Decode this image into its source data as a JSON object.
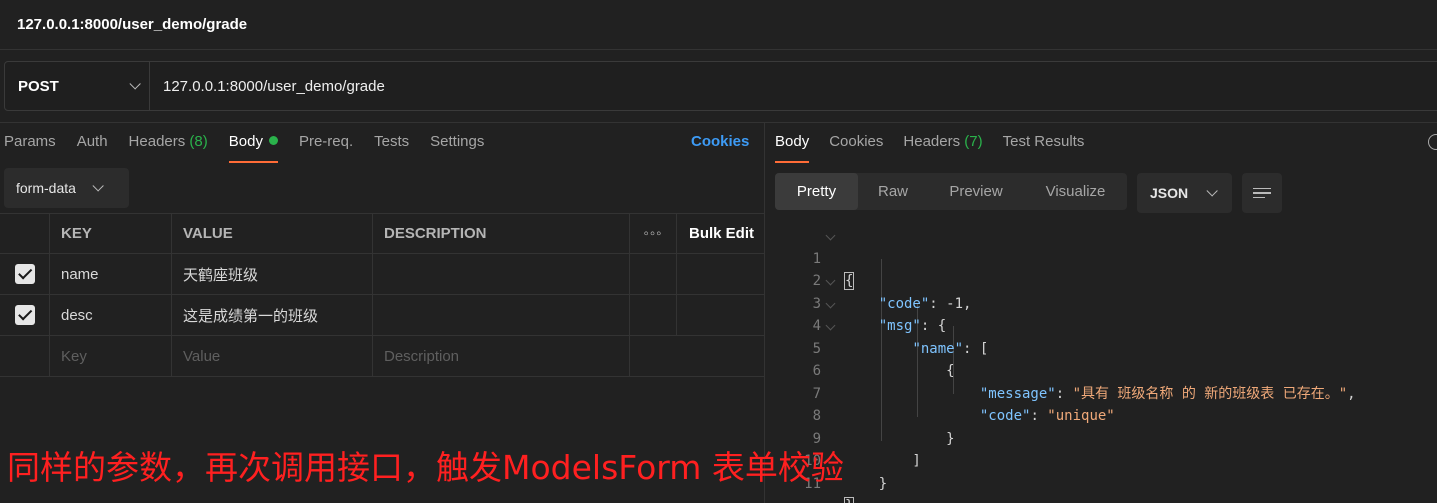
{
  "title": "127.0.0.1:8000/user_demo/grade",
  "request": {
    "method": "POST",
    "url": "127.0.0.1:8000/user_demo/grade"
  },
  "request_tabs": {
    "params": "Params",
    "auth": "Auth",
    "headers": "Headers",
    "headers_count": "(8)",
    "body": "Body",
    "prereq": "Pre-req.",
    "tests": "Tests",
    "settings": "Settings",
    "cookies": "Cookies"
  },
  "body_type": "form-data",
  "params_table": {
    "headers": {
      "key": "KEY",
      "value": "VALUE",
      "description": "DESCRIPTION",
      "more": "◦◦◦",
      "bulk_edit": "Bulk Edit"
    },
    "rows": [
      {
        "key": "name",
        "value": "天鹤座班级",
        "description": "",
        "checked": true
      },
      {
        "key": "desc",
        "value": "这是成绩第一的班级",
        "description": "",
        "checked": true
      }
    ],
    "placeholders": {
      "key": "Key",
      "value": "Value",
      "description": "Description"
    }
  },
  "response_tabs": {
    "body": "Body",
    "cookies": "Cookies",
    "headers": "Headers",
    "headers_count": "(7)",
    "test_results": "Test Results"
  },
  "view_modes": {
    "pretty": "Pretty",
    "raw": "Raw",
    "preview": "Preview",
    "visualize": "Visualize"
  },
  "format": "JSON",
  "response_lines": [
    "1",
    "2",
    "3",
    "4",
    "5",
    "6",
    "7",
    "8",
    "9",
    "10",
    "11"
  ],
  "response_json": {
    "code_key": "\"code\"",
    "code_val": "-1",
    "msg_key": "\"msg\"",
    "name_key": "\"name\"",
    "message_key": "\"message\"",
    "message_val": "\"具有 班级名称 的 新的班级表 已存在。\"",
    "inner_code_key": "\"code\"",
    "inner_code_val": "\"unique\""
  },
  "annotation": "同样的参数，再次调用接口，触发ModelsForm 表单校验"
}
